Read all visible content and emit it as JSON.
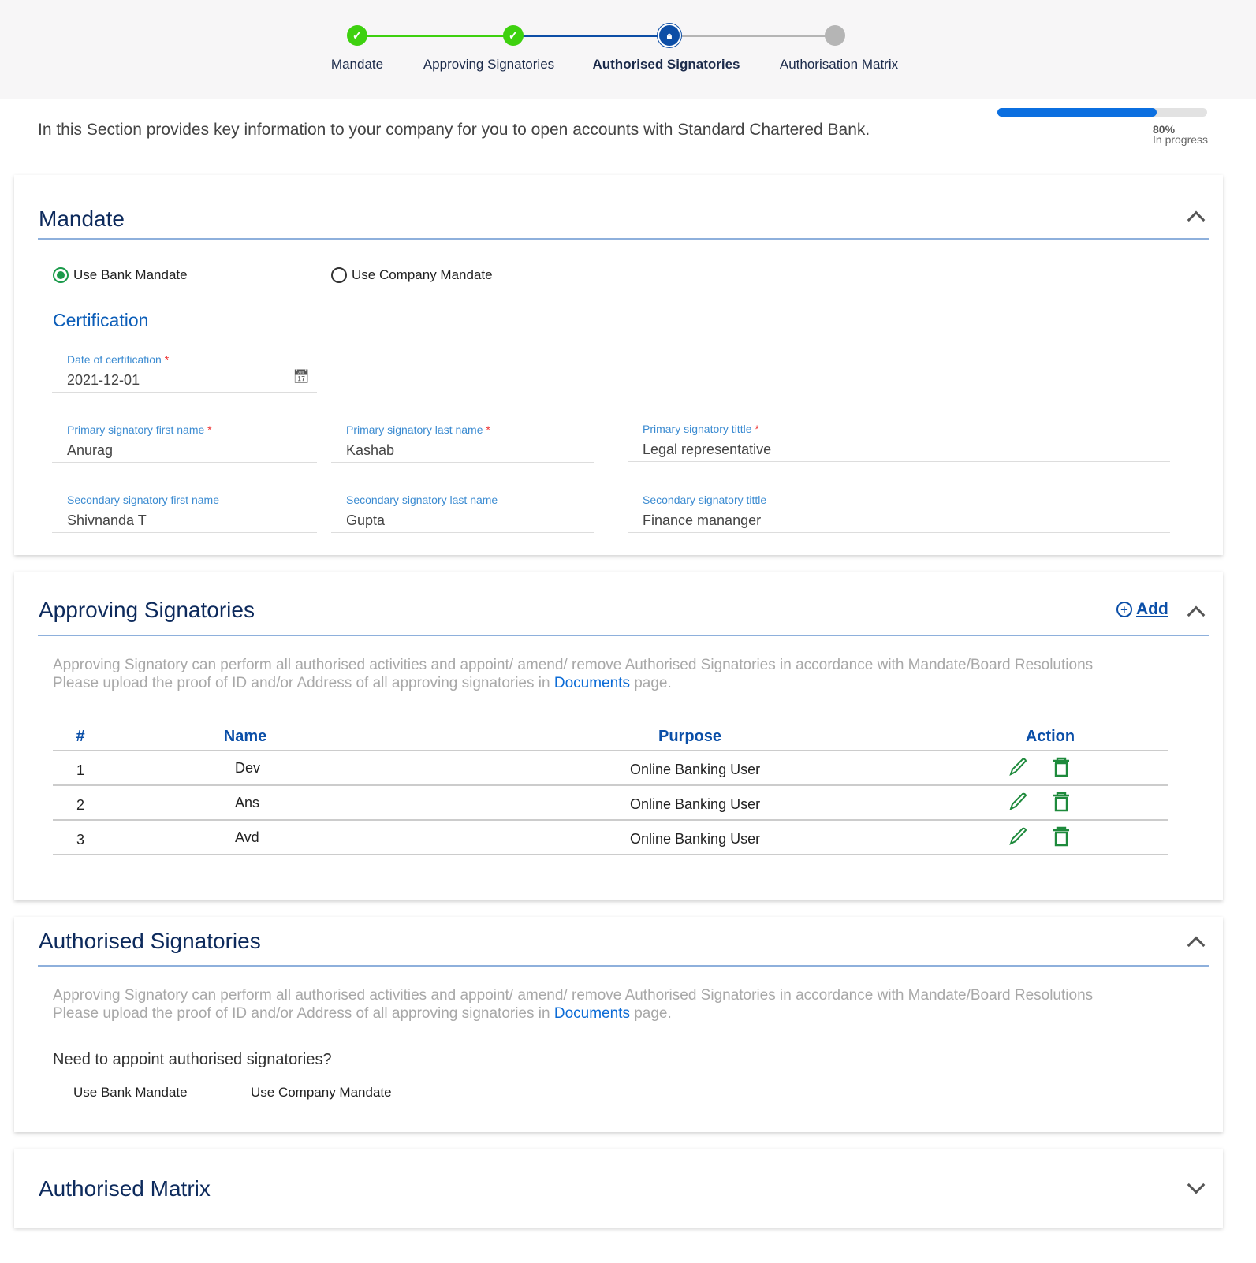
{
  "stepper": {
    "steps": [
      {
        "label": "Mandate",
        "state": "done"
      },
      {
        "label": "Approving Signatories",
        "state": "done"
      },
      {
        "label": "Authorised Signatories",
        "state": "current",
        "icon": "lock-icon"
      },
      {
        "label": "Authorisation Matrix",
        "state": "pending"
      }
    ],
    "colors": {
      "done": "#3ed10f",
      "current": "#0d4ea6",
      "pending": "#b5b5b5"
    }
  },
  "intro": "In this Section provides key information to your company for you to open accounts with Standard Chartered Bank.",
  "progress": {
    "percent": 80,
    "percent_label": "80%",
    "status": "In progress",
    "color": "#0b6fe0"
  },
  "mandate": {
    "title": "Mandate",
    "radios": [
      {
        "label": "Use Bank Mandate",
        "selected": true
      },
      {
        "label": "Use Company Mandate",
        "selected": false
      }
    ],
    "certification_title": "Certification",
    "fields": {
      "date": {
        "label": "Date of certification",
        "value": "2021-12-01",
        "required": "*"
      },
      "p_first": {
        "label": "Primary signatory first name",
        "value": "Anurag",
        "required": "*"
      },
      "p_last": {
        "label": "Primary signatory last name",
        "value": "Kashab",
        "required": "*"
      },
      "p_title": {
        "label": "Primary signatory tittle",
        "value": "Legal representative",
        "required": "*"
      },
      "s_first": {
        "label": "Secondary signatory first name",
        "value": "Shivnanda T"
      },
      "s_last": {
        "label": "Secondary signatory last name",
        "value": "Gupta"
      },
      "s_title": {
        "label": "Secondary signatory tittle",
        "value": "Finance mananger"
      }
    }
  },
  "approving": {
    "title": "Approving Signatories",
    "add_label": "Add",
    "desc1": "Approving Signatory can perform all authorised activities and appoint/ amend/ remove Authorised Signatories in accordance with Mandate/Board Resolutions",
    "desc2_pre": "Please upload the proof of ID and/or Address of all approving signatories in ",
    "desc2_link": "Documents",
    "desc2_post": " page.",
    "columns": [
      "#",
      "Name",
      "Purpose",
      "Action"
    ],
    "rows": [
      {
        "n": "1",
        "name": "Dev",
        "purpose": "Online Banking User"
      },
      {
        "n": "2",
        "name": "Ans",
        "purpose": "Online Banking User"
      },
      {
        "n": "3",
        "name": "Avd",
        "purpose": "Online Banking User"
      }
    ]
  },
  "authorised": {
    "title": "Authorised Signatories",
    "desc1": "Approving Signatory can perform all authorised activities and appoint/ amend/ remove Authorised Signatories in accordance with Mandate/Board Resolutions",
    "desc2_pre": "Please upload the proof of ID and/or Address of all approving signatories in ",
    "desc2_link": "Documents",
    "desc2_post": " page.",
    "question": "Need to appoint authorised signatories?",
    "options": [
      "Use Bank Mandate",
      "Use Company Mandate"
    ]
  },
  "matrix": {
    "title": "Authorised Matrix"
  }
}
